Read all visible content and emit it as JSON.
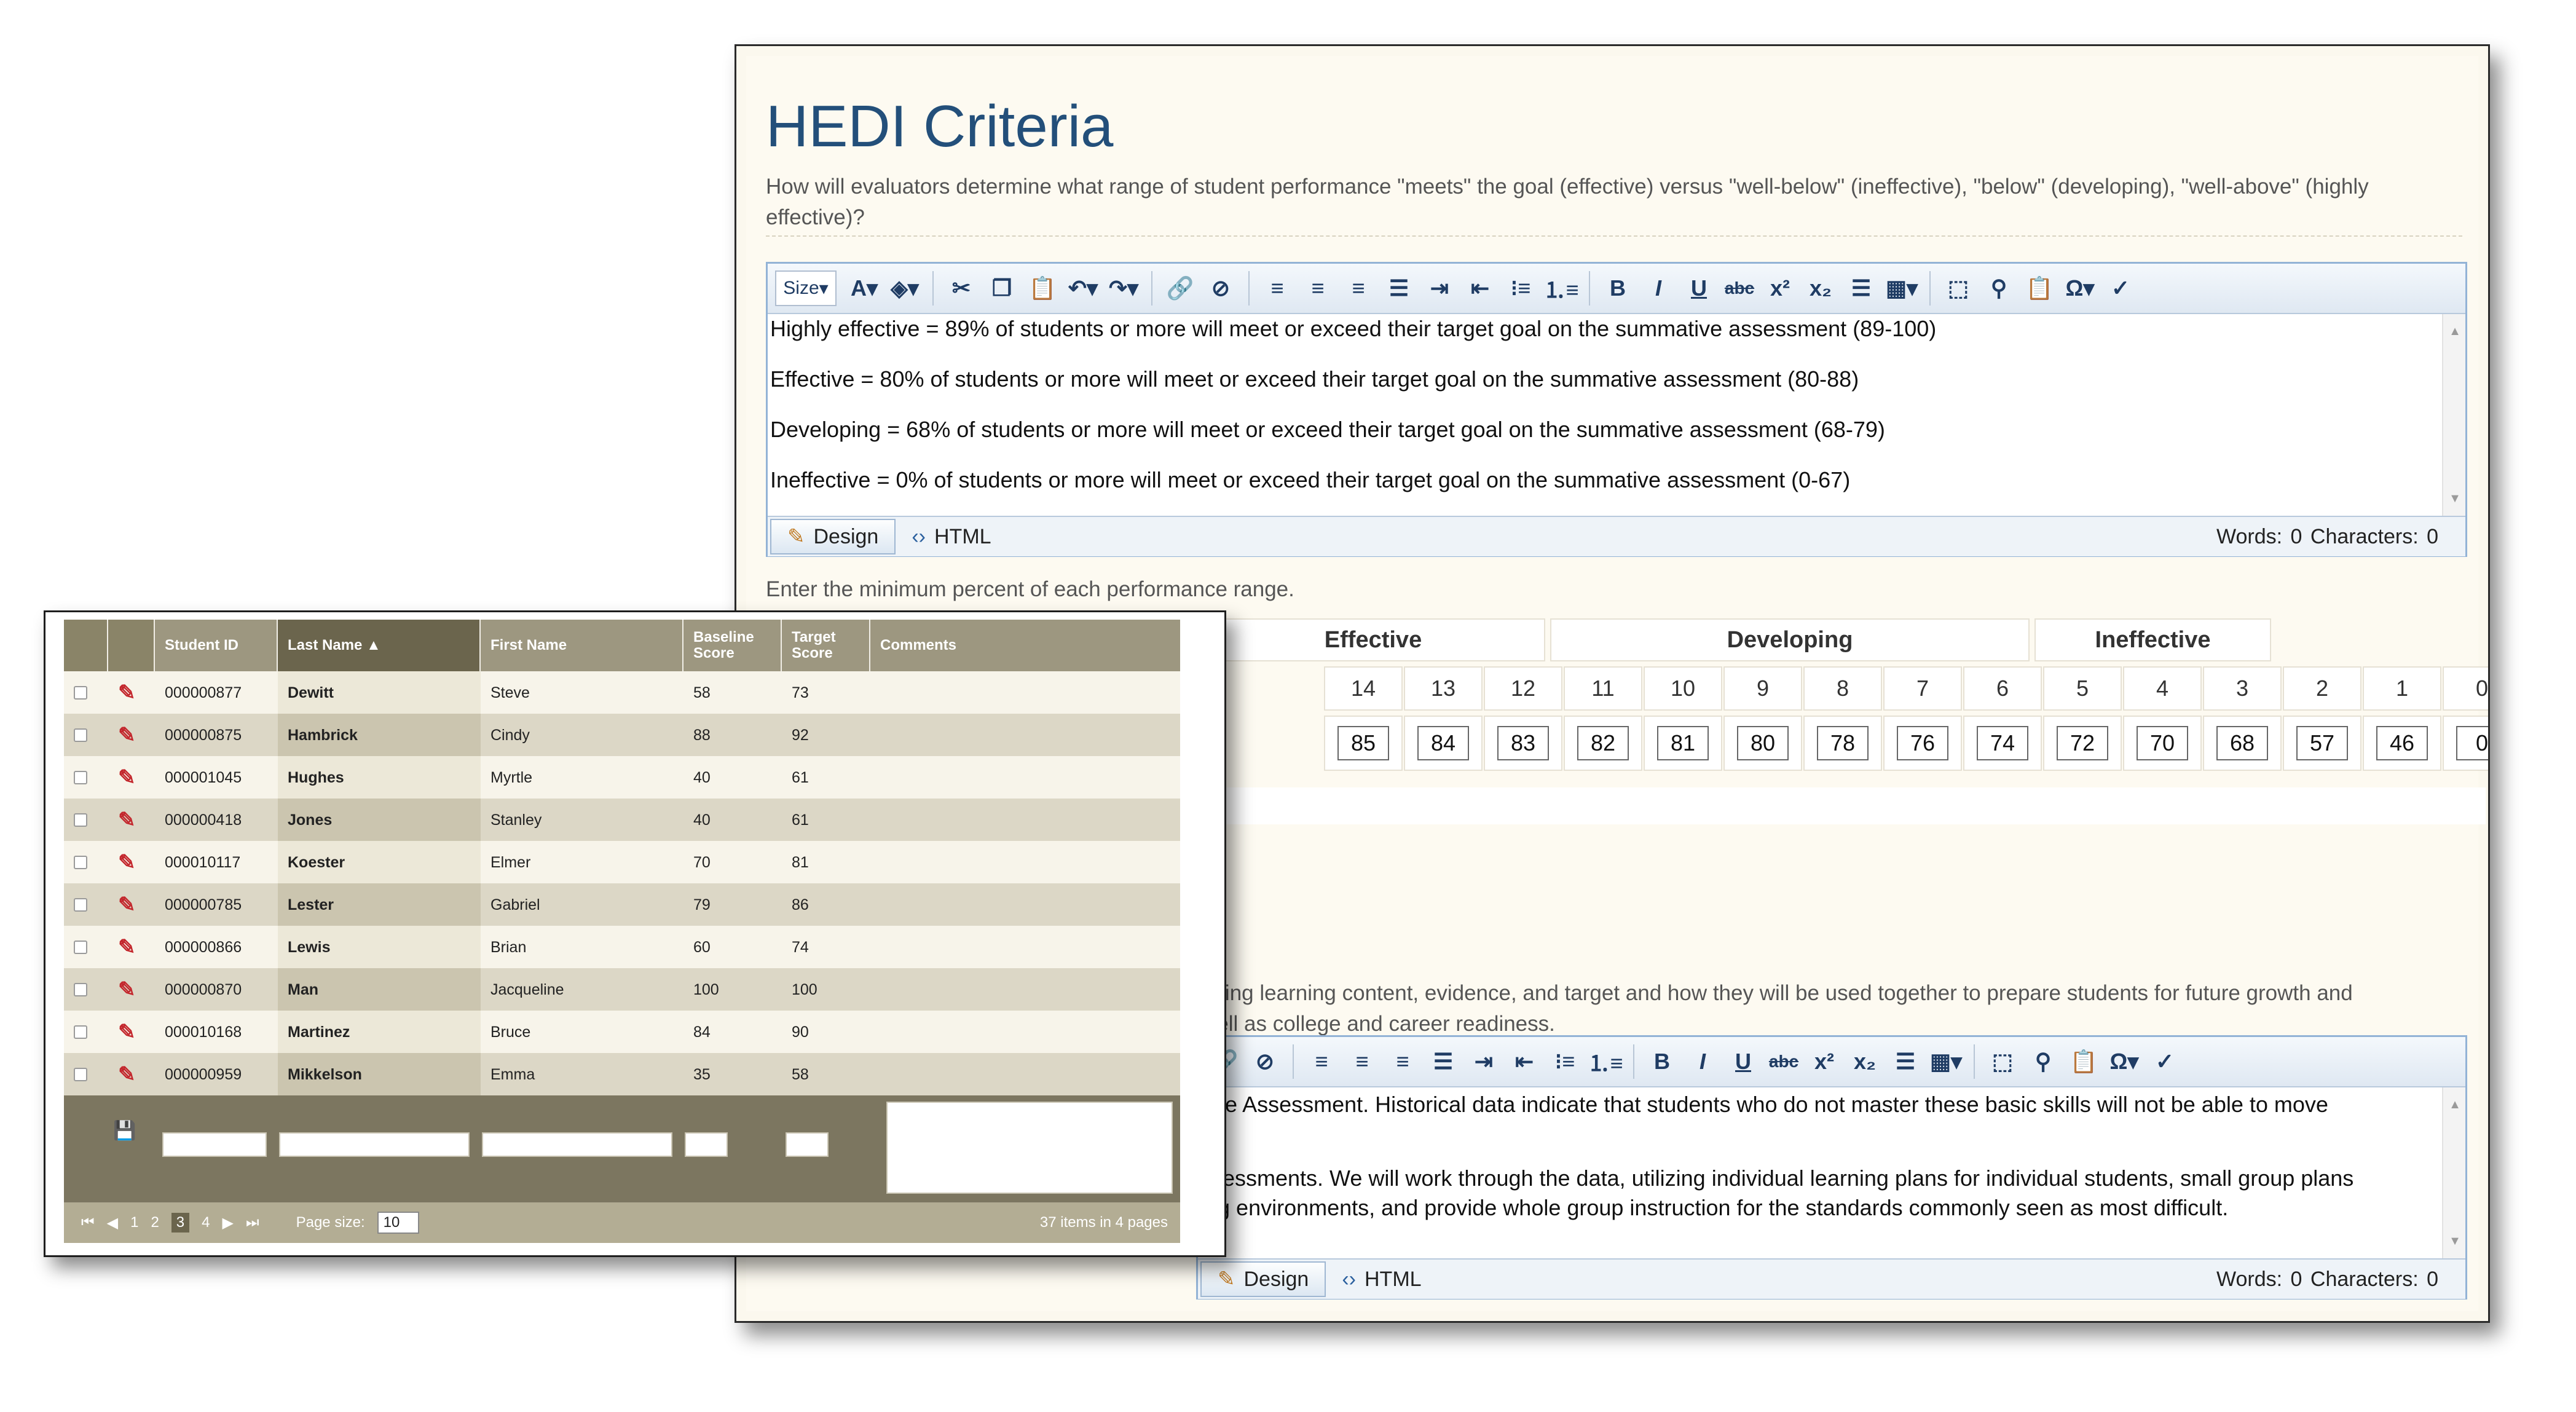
{
  "hedi": {
    "title": "HEDI Criteria",
    "description": "How will evaluators determine what range of student performance \"meets\" the goal (effective) versus \"well-below\" (ineffective), \"below\" (developing), \"well-above\" (highly effective)?",
    "toolbar": {
      "size_label": "Size"
    },
    "editor_lines": [
      "Highly effective = 89% of students or more will meet or exceed their target goal on the summative assessment (89-100)",
      "Effective = 80% of students or more will meet or exceed their target goal on the summative assessment (80-88)",
      "Developing = 68% of students or more will meet or exceed their target goal on the summative assessment (68-79)",
      "Ineffective = 0% of students or more will meet or exceed their target goal on the summative assessment (0-67)"
    ],
    "design_label": "Design",
    "html_label": "HTML",
    "counts": "Words: 0   Characters: 0",
    "min_label": "Enter the minimum percent of each performance range.",
    "ranges": {
      "headers": [
        "Effective",
        "Developing",
        "Ineffective"
      ],
      "points": [
        "14",
        "13",
        "12",
        "11",
        "10",
        "9",
        "8",
        "7",
        "6",
        "5",
        "4",
        "3",
        "2",
        "1",
        "0"
      ],
      "values": [
        "85",
        "84",
        "83",
        "82",
        "81",
        "80",
        "78",
        "76",
        "74",
        "72",
        "70",
        "68",
        "57",
        "46",
        "0"
      ]
    },
    "section2_text": [
      "ading learning content, evidence, and target and how they will be used together to prepare students for future growth and",
      "well as college and career readiness."
    ],
    "editor2_lines": [
      "tate Assessment.  Historical data indicate that students who do not master these basic skills will not be able to move",
      "ssessments.  We will work through the data, utilizing individual learning plans for individual students, small group plans",
      "ing environments, and provide whole group instruction for the standards commonly seen as most difficult."
    ]
  },
  "grid": {
    "columns": [
      "Student ID",
      "Last Name ▲",
      "First Name",
      "Baseline Score",
      "Target Score",
      "Comments"
    ],
    "rows": [
      {
        "id": "000000877",
        "last": "Dewitt",
        "first": "Steve",
        "baseline": "58",
        "target": "73"
      },
      {
        "id": "000000875",
        "last": "Hambrick",
        "first": "Cindy",
        "baseline": "88",
        "target": "92"
      },
      {
        "id": "000001045",
        "last": "Hughes",
        "first": "Myrtle",
        "baseline": "40",
        "target": "61"
      },
      {
        "id": "000000418",
        "last": "Jones",
        "first": "Stanley",
        "baseline": "40",
        "target": "61"
      },
      {
        "id": "000010117",
        "last": "Koester",
        "first": "Elmer",
        "baseline": "70",
        "target": "81"
      },
      {
        "id": "000000785",
        "last": "Lester",
        "first": "Gabriel",
        "baseline": "79",
        "target": "86"
      },
      {
        "id": "000000866",
        "last": "Lewis",
        "first": "Brian",
        "baseline": "60",
        "target": "74"
      },
      {
        "id": "000000870",
        "last": "Man",
        "first": "Jacqueline",
        "baseline": "100",
        "target": "100"
      },
      {
        "id": "000010168",
        "last": "Martinez",
        "first": "Bruce",
        "baseline": "84",
        "target": "90"
      },
      {
        "id": "000000959",
        "last": "Mikkelson",
        "first": "Emma",
        "baseline": "35",
        "target": "58"
      }
    ],
    "pager": {
      "pages": [
        "1",
        "2",
        "3",
        "4"
      ],
      "current": "3",
      "page_size_label": "Page size:",
      "page_size": "10",
      "summary": "37 items in 4 pages"
    }
  }
}
